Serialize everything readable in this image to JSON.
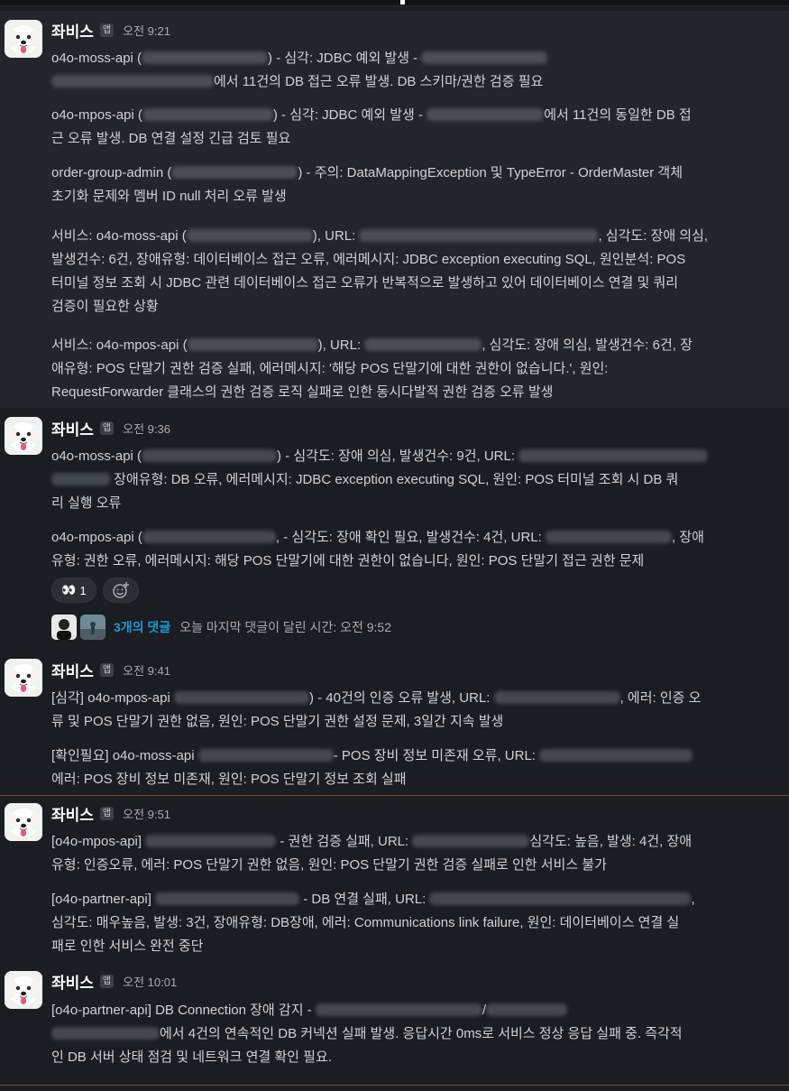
{
  "messages": [
    {
      "sender": "좌비스",
      "badge": "앱",
      "time": "오전 9:21",
      "paragraphs": [
        [
          [
            {
              "t": "o4o-moss-api ("
            },
            {
              "b": 140
            },
            {
              "t": ") - 심각: JDBC 예외 발생 - "
            },
            {
              "b": 140
            }
          ],
          [
            {
              "b": 180
            },
            {
              "t": "에서 11건의 DB 접근 오류 발생. DB 스키마/권한 검증 필요"
            }
          ]
        ],
        [
          [
            {
              "t": "o4o-mpos-api ("
            },
            {
              "b": 145
            },
            {
              "t": ") - 심각: JDBC 예외 발생 - "
            },
            {
              "b": 130
            },
            {
              "t": "에서 11건의 동일한 DB 접"
            }
          ],
          [
            {
              "t": "근 오류 발생. DB 연결 설정 긴급 검토 필요"
            }
          ]
        ],
        [
          [
            {
              "t": "order-group-admin ("
            },
            {
              "b": 140
            },
            {
              "t": ") - 주의: DataMappingException 및 TypeError - OrderMaster 객체"
            }
          ],
          [
            {
              "t": "초기화 문제와 멤버 ID null 처리 오류 발생"
            }
          ]
        ],
        [
          [
            {
              "t": "서비스: o4o-moss-api ("
            },
            {
              "b": 140
            },
            {
              "t": "), URL: "
            },
            {
              "b": 265
            },
            {
              "t": ", 심각도: 장애 의심,"
            }
          ],
          [
            {
              "t": "발생건수: 6건, 장애유형: 데이터베이스 접근 오류, 에러메시지: JDBC exception executing SQL, 원인분석: POS"
            }
          ],
          [
            {
              "t": "터미널 정보 조회 시 JDBC 관련 데이터베이스 접근 오류가 반복적으로 발생하고 있어 데이터베이스 연결 및 쿼리"
            }
          ],
          [
            {
              "t": "검증이 필요한 상황"
            }
          ]
        ],
        [
          [
            {
              "t": "서비스: o4o-mpos-api ("
            },
            {
              "b": 145
            },
            {
              "t": "), URL: "
            },
            {
              "b": 130
            },
            {
              "t": ", 심각도: 장애 의심, 발생건수: 6건, 장"
            }
          ],
          [
            {
              "t": "애유형: POS 단말기 권한 검증 실패, 에러메시지: '해당 POS 단말기에 대한 권한이 없습니다.', 원인:"
            }
          ],
          [
            {
              "t": "RequestForwarder 클래스의 권한 검증 로직 실패로 인한 동시다발적 권한 검증 오류 발생"
            }
          ]
        ]
      ]
    },
    {
      "sender": "좌비스",
      "badge": "앱",
      "time": "오전 9:36",
      "paragraphs": [
        [
          [
            {
              "t": "o4o-moss-api ("
            },
            {
              "b": 150
            },
            {
              "t": ") - 심각도: 장애 의심, 발생건수: 9건, URL: "
            },
            {
              "b": 210
            }
          ],
          [
            {
              "b": 65
            },
            {
              "t": " 장애유형: DB 오류, 에러메시지: JDBC exception executing SQL, 원인: POS 터미널 조회 시 DB 쿼"
            }
          ],
          [
            {
              "t": "리 실행 오류"
            }
          ]
        ],
        [
          [
            {
              "t": "o4o-mpos-api ("
            },
            {
              "b": 148
            },
            {
              "t": ", - 심각도: 장애 확인 필요, 발생건수: 4건, URL: "
            },
            {
              "b": 140
            },
            {
              "t": ", 장애"
            }
          ],
          [
            {
              "t": "유형: 권한 오류, 에러메시지: 해당 POS 단말기에 대한 권한이 없습니다, 원인: POS 단말기 접근 권한 문제"
            }
          ]
        ]
      ],
      "reaction": {
        "emoji_icon": "eyes-icon",
        "glyph": "👀",
        "count": "1"
      },
      "thread": {
        "replies": "3개의 댓글",
        "last_reply": "오늘 마지막 댓글이 달린 시간: 오전 9:52"
      }
    },
    {
      "sender": "좌비스",
      "badge": "앱",
      "time": "오전 9:41",
      "paragraphs": [
        [
          [
            {
              "t": "[심각] o4o-mpos-api "
            },
            {
              "b": 150
            },
            {
              "t": ") - 40건의 인증 오류 발생, URL: "
            },
            {
              "b": 140
            },
            {
              "t": ", 에러: 인증 오"
            }
          ],
          [
            {
              "t": "류 및 POS 단말기 권한 없음, 원인: POS 단말기 권한 설정 문제, 3일간 지속 발생"
            }
          ]
        ],
        [
          [
            {
              "t": "[확인필요] o4o-moss-api "
            },
            {
              "b": 150
            },
            {
              "t": "- POS 장비 정보 미존재 오류, URL: "
            },
            {
              "b": 170
            }
          ],
          [
            {
              "t": "에러: POS 장비 정보 미존재, 원인: POS 단말기 정보 조회 실패"
            }
          ]
        ]
      ]
    },
    {
      "sender": "좌비스",
      "badge": "앱",
      "time": "오전 9:51",
      "paragraphs": [
        [
          [
            {
              "t": "[o4o-mpos-api] "
            },
            {
              "b": 145
            },
            {
              "t": " - 권한 검증 실패, URL: "
            },
            {
              "b": 130
            },
            {
              "t": "심각도: 높음, 발생: 4건, 장애"
            }
          ],
          [
            {
              "t": "유형: 인증오류, 에러: POS 단말기 권한 없음, 원인: POS 단말기 권한 검증 실패로 인한 서비스 불가"
            }
          ]
        ],
        [
          [
            {
              "t": "[o4o-partner-api] "
            },
            {
              "b": 160
            },
            {
              "t": " - DB 연결 실패, URL: "
            },
            {
              "b": 290
            },
            {
              "t": ","
            }
          ],
          [
            {
              "t": "심각도: 매우높음, 발생: 3건, 장애유형: DB장애, 에러: Communications link failure, 원인: 데이터베이스 연결 실"
            }
          ],
          [
            {
              "t": "패로 인한 서비스 완전 중단"
            }
          ]
        ]
      ]
    },
    {
      "sender": "좌비스",
      "badge": "앱",
      "time": "오전 10:01",
      "paragraphs": [
        [
          [
            {
              "t": "[o4o-partner-api] DB Connection 장애 감지 - "
            },
            {
              "b": 185
            },
            {
              "t": "/"
            },
            {
              "b": 90
            }
          ],
          [
            {
              "b": 120
            },
            {
              "t": "에서 4건의 연속적인 DB 커넥션 실패 발생. 응답시간 0ms로 서비스 정상 응답 실패 중. 즉각적"
            }
          ],
          [
            {
              "t": "인 DB 서버 상태 점검 및 네트워크 연결 확인 필요."
            }
          ]
        ]
      ]
    }
  ]
}
